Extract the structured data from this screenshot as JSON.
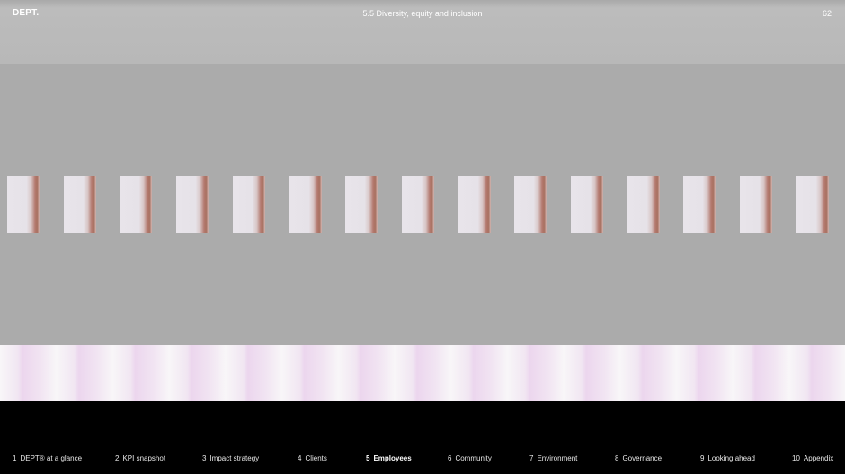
{
  "header": {
    "logo": "DEPT.",
    "section_title": "5.5 Diversity, equity and inclusion",
    "page_number": "62"
  },
  "footer_nav": [
    {
      "num": "1",
      "label": "DEPT® at a glance",
      "active": false
    },
    {
      "num": "2",
      "label": "KPI snapshot",
      "active": false
    },
    {
      "num": "3",
      "label": "Impact strategy",
      "active": false
    },
    {
      "num": "4",
      "label": "Clients",
      "active": false
    },
    {
      "num": "5",
      "label": "Employees",
      "active": true
    },
    {
      "num": "6",
      "label": "Community",
      "active": false
    },
    {
      "num": "7",
      "label": "Environment",
      "active": false
    },
    {
      "num": "8",
      "label": "Governance",
      "active": false
    },
    {
      "num": "9",
      "label": "Looking ahead",
      "active": false
    },
    {
      "num": "10",
      "label": "Appendix",
      "active": false
    }
  ],
  "colors": {
    "header_bg": "#b8b8b8",
    "stage_bg": "#ababab",
    "footer_bg": "#000000",
    "text": "#ffffff"
  }
}
